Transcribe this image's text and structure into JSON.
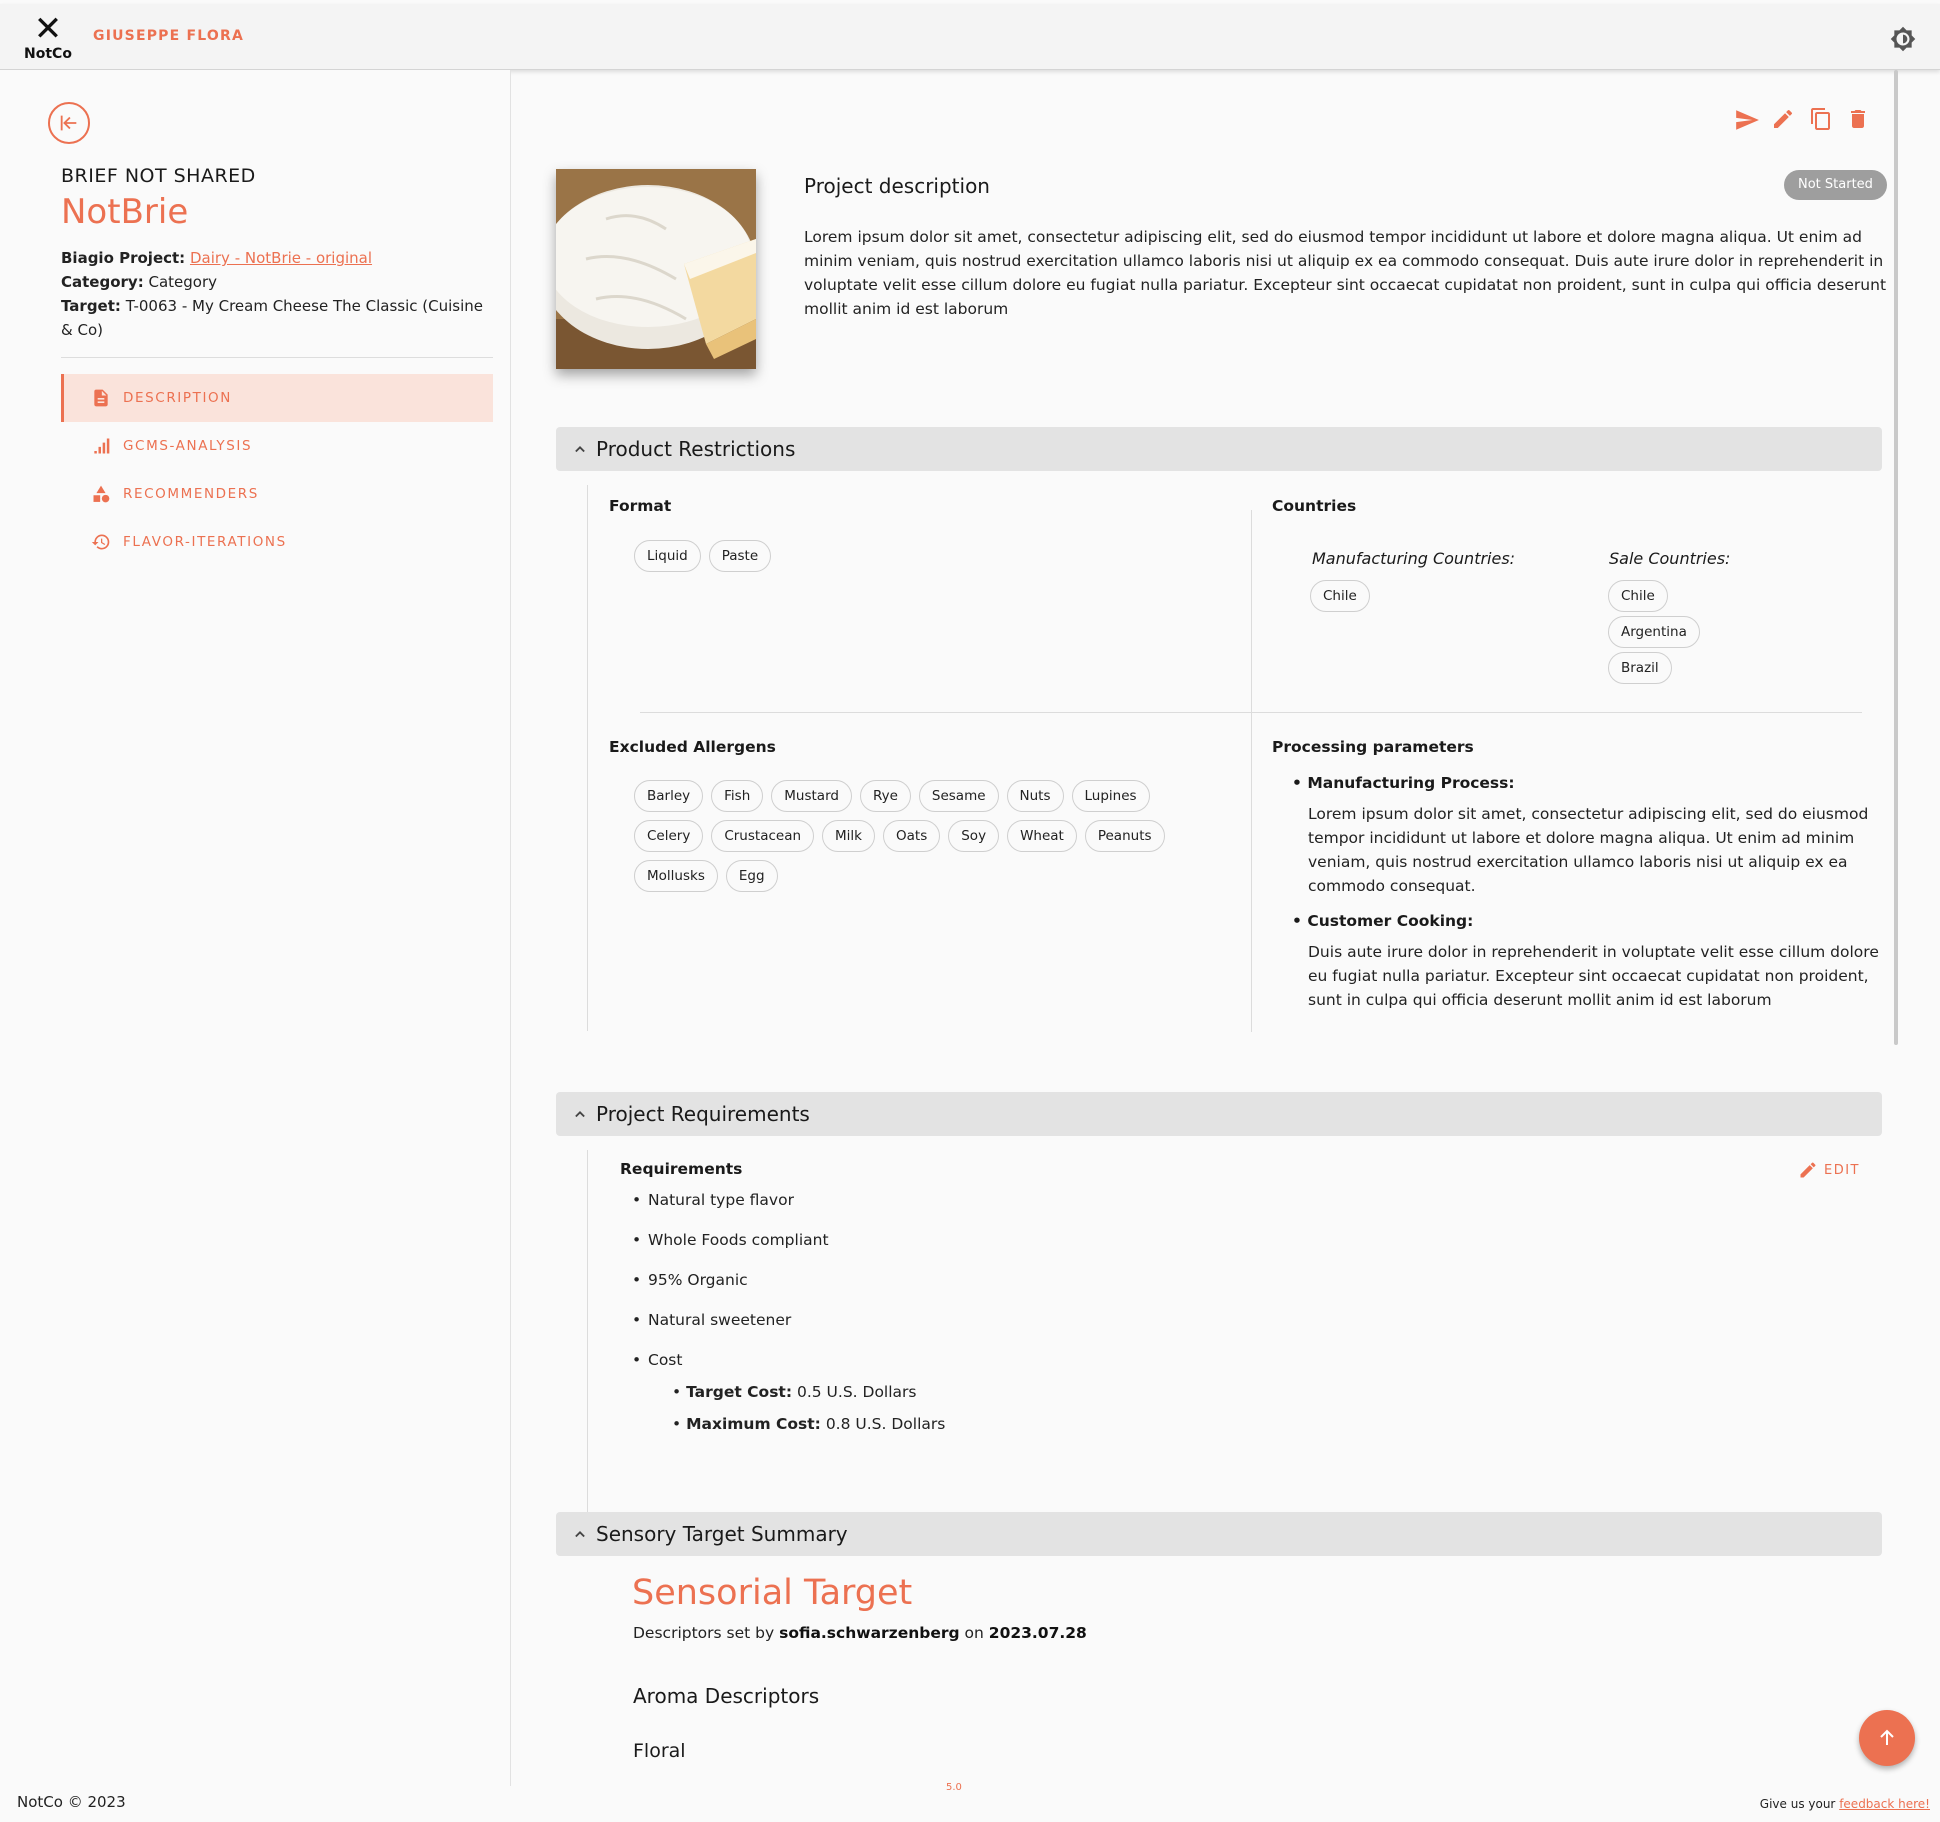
{
  "header": {
    "logo_mark": "✕",
    "logo_text": "NotCo",
    "user_name": "GIUSEPPE FLORA",
    "theme_icon": "brightness-icon"
  },
  "colors": {
    "accent": "#ec7151",
    "accent_light": "#fae3db",
    "badge": "#9e9e9e",
    "section_bg": "#e3e3e3"
  },
  "sidebar": {
    "status": "BRIEF NOT SHARED",
    "title": "NotBrie",
    "biagio_label": "Biagio Project:",
    "biagio_value": "Dairy - NotBrie - original",
    "category_label": "Category:",
    "category_value": "Category",
    "target_label": "Target:",
    "target_value": "T-0063 - My Cream Cheese The Classic (Cuisine & Co)",
    "nav": [
      {
        "label": "DESCRIPTION",
        "icon": "document-icon",
        "active": true
      },
      {
        "label": "GCMS-ANALYSIS",
        "icon": "bar-chart-icon",
        "active": false
      },
      {
        "label": "RECOMMENDERS",
        "icon": "shapes-icon",
        "active": false
      },
      {
        "label": "FLAVOR-ITERATIONS",
        "icon": "history-icon",
        "active": false
      }
    ]
  },
  "project": {
    "description_title": "Project description",
    "status": "Not Started",
    "description": "Lorem ipsum dolor sit amet, consectetur adipiscing elit, sed do eiusmod tempor incididunt ut labore et dolore magna aliqua. Ut enim ad minim veniam, quis nostrud exercitation ullamco laboris nisi ut aliquip ex ea commodo consequat. Duis aute irure dolor in reprehenderit in voluptate velit esse cillum dolore eu fugiat nulla pariatur. Excepteur sint occaecat cupidatat non proident, sunt in culpa qui officia deserunt mollit anim id est laborum"
  },
  "restrictions": {
    "section_title": "Product Restrictions",
    "format_label": "Format",
    "formats": [
      "Liquid",
      "Paste"
    ],
    "countries_label": "Countries",
    "manufacturing_label": "Manufacturing Countries:",
    "manufacturing": [
      "Chile"
    ],
    "sale_label": "Sale Countries:",
    "sale": [
      "Chile",
      "Argentina",
      "Brazil"
    ],
    "allergens_label": "Excluded Allergens",
    "allergens": [
      "Barley",
      "Fish",
      "Mustard",
      "Rye",
      "Sesame",
      "Nuts",
      "Lupines",
      "Celery",
      "Crustacean",
      "Milk",
      "Oats",
      "Soy",
      "Wheat",
      "Peanuts",
      "Mollusks",
      "Egg"
    ],
    "processing_label": "Processing parameters",
    "manufacturing_process_label": "Manufacturing Process:",
    "manufacturing_process": "Lorem ipsum dolor sit amet, consectetur adipiscing elit, sed do eiusmod tempor incididunt ut labore et dolore magna aliqua. Ut enim ad minim veniam, quis nostrud exercitation ullamco laboris nisi ut aliquip ex ea commodo consequat.",
    "customer_cooking_label": "Customer Cooking:",
    "customer_cooking": "Duis aute irure dolor in reprehenderit in voluptate velit esse cillum dolore eu fugiat nulla pariatur. Excepteur sint occaecat cupidatat non proident, sunt in culpa qui officia deserunt mollit anim id est laborum"
  },
  "requirements": {
    "section_title": "Project Requirements",
    "label": "Requirements",
    "edit_label": "EDIT",
    "items": [
      "Natural type flavor",
      "Whole Foods compliant",
      "95% Organic",
      "Natural sweetener",
      "Cost"
    ],
    "target_cost_label": "Target Cost:",
    "target_cost": "0.5 U.S. Dollars",
    "max_cost_label": "Maximum Cost:",
    "max_cost": "0.8 U.S. Dollars"
  },
  "sensory": {
    "section_title": "Sensory Target Summary",
    "title": "Sensorial Target",
    "set_by_prefix": "Descriptors set by",
    "set_by_user": "sofia.schwarzenberg",
    "on_word": "on",
    "date": "2023.07.28",
    "aroma_title": "Aroma Descriptors",
    "first_group": "Floral",
    "stub": "5.0"
  },
  "footer": {
    "copyright": "NotCo © 2023",
    "feedback_prefix": "Give us your",
    "feedback_link": "feedback here!"
  }
}
